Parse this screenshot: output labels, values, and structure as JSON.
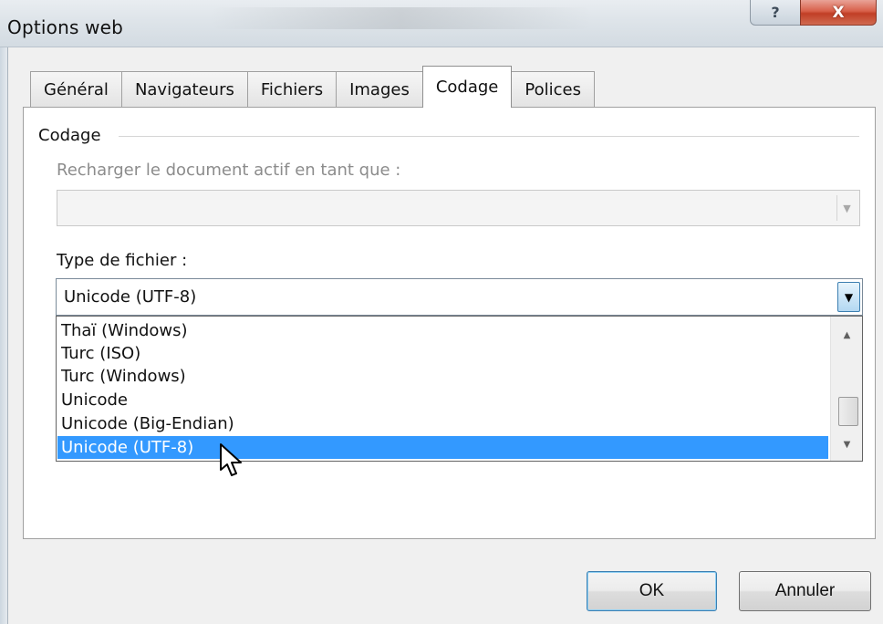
{
  "window": {
    "title": "Options web",
    "help_glyph": "?",
    "close_glyph": "X"
  },
  "tabs": [
    {
      "label": "Général",
      "active": false
    },
    {
      "label": "Navigateurs",
      "active": false
    },
    {
      "label": "Fichiers",
      "active": false
    },
    {
      "label": "Images",
      "active": false
    },
    {
      "label": "Codage",
      "active": true
    },
    {
      "label": "Polices",
      "active": false
    }
  ],
  "codage": {
    "group_label": "Codage",
    "reload_label": "Recharger le document actif en tant que :",
    "reload_value": "",
    "file_type_label_pre": "Type de f",
    "file_type_label_mnemonic": "i",
    "file_type_label_post": "chier :",
    "file_type_value": "Unicode (UTF-8)",
    "options": [
      {
        "label": "Thaï (Windows)",
        "selected": false
      },
      {
        "label": "Turc (ISO)",
        "selected": false
      },
      {
        "label": "Turc (Windows)",
        "selected": false
      },
      {
        "label": "Unicode",
        "selected": false
      },
      {
        "label": "Unicode (Big-Endian)",
        "selected": false
      },
      {
        "label": "Unicode (UTF-8)",
        "selected": true
      }
    ]
  },
  "buttons": {
    "ok": "OK",
    "cancel": "Annuler"
  },
  "colors": {
    "selection": "#3399ff",
    "close_button": "#c13f26",
    "default_button_border": "#3c7fb1"
  },
  "icons": {
    "dropdown_arrow": "chevron-down-icon",
    "scroll_up": "triangle-up-icon",
    "scroll_down": "triangle-down-icon",
    "cursor": "mouse-pointer-icon"
  }
}
